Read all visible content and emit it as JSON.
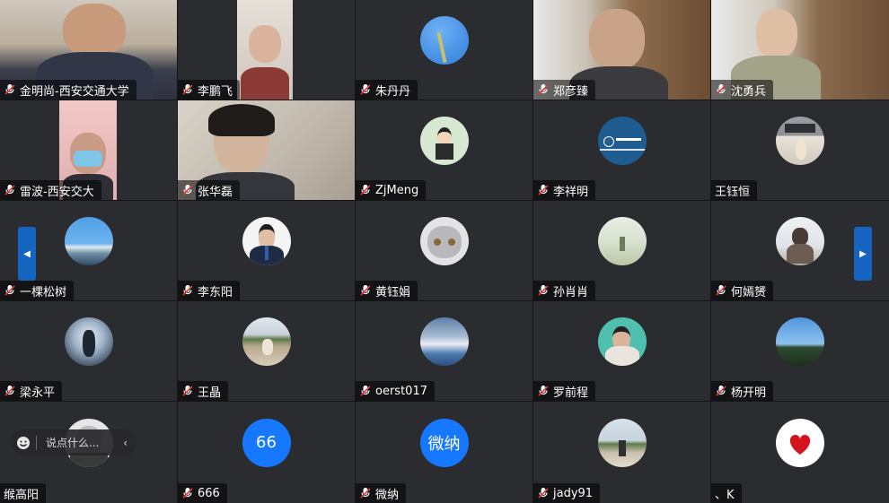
{
  "participants": [
    {
      "name": "金明尚-西安交通大学",
      "mic": true
    },
    {
      "name": "李鹏飞",
      "mic": true
    },
    {
      "name": "朱丹丹",
      "mic": true
    },
    {
      "name": "郑彦臻",
      "mic": true
    },
    {
      "name": "沈勇兵",
      "mic": true
    },
    {
      "name": "雷波-西安交大",
      "mic": true
    },
    {
      "name": "张华磊",
      "mic": true
    },
    {
      "name": "ZjMeng",
      "mic": true
    },
    {
      "name": "李祥明",
      "mic": true
    },
    {
      "name": "王钰恒",
      "mic": false
    },
    {
      "name": "一棵松树",
      "mic": true
    },
    {
      "name": "李东阳",
      "mic": true
    },
    {
      "name": "黄钰娟",
      "mic": true
    },
    {
      "name": "孙肖肖",
      "mic": true
    },
    {
      "name": "何嫣赟",
      "mic": true
    },
    {
      "name": "梁永平",
      "mic": true
    },
    {
      "name": "王晶",
      "mic": true
    },
    {
      "name": "oerst017",
      "mic": true
    },
    {
      "name": "罗前程",
      "mic": true
    },
    {
      "name": "杨开明",
      "mic": true
    },
    {
      "name": "缑高阳",
      "mic": false
    },
    {
      "name": "666",
      "mic": true,
      "avatar_text": "66"
    },
    {
      "name": "微纳",
      "mic": true,
      "avatar_text": "微纳"
    },
    {
      "name": "jady91",
      "mic": true
    },
    {
      "name": "、K",
      "mic": false
    }
  ],
  "chat": {
    "placeholder": "说点什么..."
  },
  "nav": {
    "prev_icon": "chevron-left-icon",
    "next_icon": "chevron-right-icon"
  },
  "colors": {
    "accent": "#1565c0",
    "avatar_blue": "#1677ff",
    "mic_red": "#e5393a"
  }
}
